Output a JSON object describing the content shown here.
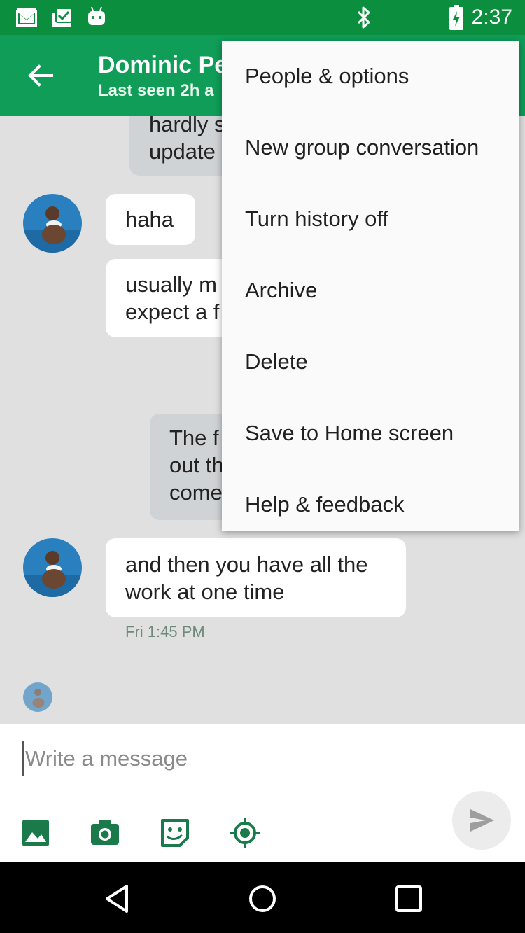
{
  "status_bar": {
    "time": "2:37",
    "left_icons": [
      "gmail-icon",
      "clipboard-check-icon",
      "android-icon"
    ],
    "right_icons": [
      "bluetooth-icon",
      "battery-icon"
    ]
  },
  "header": {
    "title": "Dominic Pe",
    "subtitle": "Last seen 2h a",
    "back_icon": "arrow-left-icon"
  },
  "messages": [
    {
      "side": "out",
      "lines": [
        "hardly s",
        "update"
      ]
    },
    {
      "side": "in",
      "lines": [
        "haha"
      ]
    },
    {
      "side": "in",
      "lines": [
        "usually m",
        "expect a f"
      ]
    },
    {
      "side": "out",
      "lines": [
        "The f",
        "out th",
        "come"
      ]
    },
    {
      "side": "in",
      "lines": [
        "and then you have all the",
        "work at one time"
      ]
    }
  ],
  "timestamp": "Fri 1:45 PM",
  "composer": {
    "placeholder": "Write a message",
    "tools": [
      "image-icon",
      "camera-icon",
      "sticker-icon",
      "location-icon"
    ],
    "send_icon": "send-icon"
  },
  "menu": {
    "items": [
      "People & options",
      "New group conversation",
      "Turn history off",
      "Archive",
      "Delete",
      "Save to Home screen",
      "Help & feedback"
    ]
  },
  "nav_bar": [
    "back-icon",
    "home-icon",
    "recents-icon"
  ],
  "colors": {
    "status_bar": "#0b8f3e",
    "app_bar": "#0f9d58",
    "chat_bg": "#e0e0e0",
    "incoming_bubble": "#ffffff",
    "outgoing_bubble": "#cfd3d5",
    "timestamp": "#6f8a7c"
  }
}
